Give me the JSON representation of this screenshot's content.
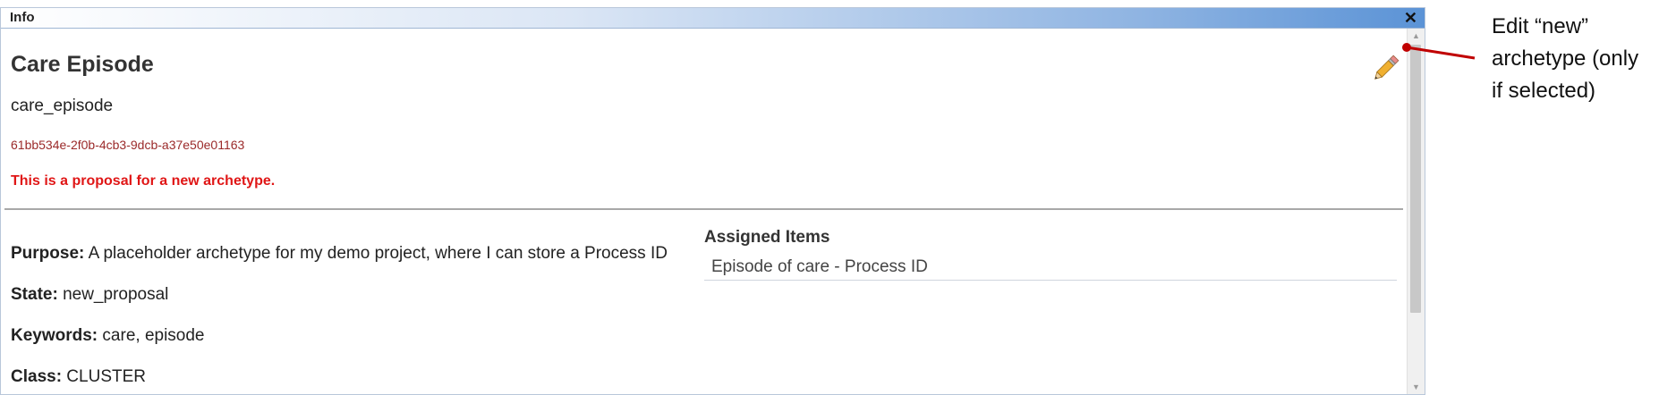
{
  "window": {
    "title": "Info",
    "close_symbol": "✕"
  },
  "archetype": {
    "display_name": "Care Episode",
    "concept_name": "care_episode",
    "uid": "61bb534e-2f0b-4cb3-9dcb-a37e50e01163",
    "proposal_notice": "This is a proposal for a new archetype."
  },
  "fields": {
    "purpose_label": "Purpose:",
    "purpose_value": " A placeholder archetype for my demo project, where I can store a Process ID",
    "state_label": "State:",
    "state_value": " new_proposal",
    "keywords_label": "Keywords:",
    "keywords_value": " care, episode",
    "class_label": "Class:",
    "class_value": " CLUSTER"
  },
  "assigned": {
    "title": "Assigned Items",
    "items": [
      "Episode of care - Process ID"
    ]
  },
  "annotation": {
    "line1": "Edit “new”",
    "line2": "archetype (only",
    "line3": "if selected)",
    "color": "#c00000"
  },
  "icons": {
    "edit": "pencil-icon",
    "close": "close-icon"
  },
  "colors": {
    "uid": "#9b2a2a",
    "proposal": "#e01616",
    "titlebar_end": "#5b93d6"
  }
}
